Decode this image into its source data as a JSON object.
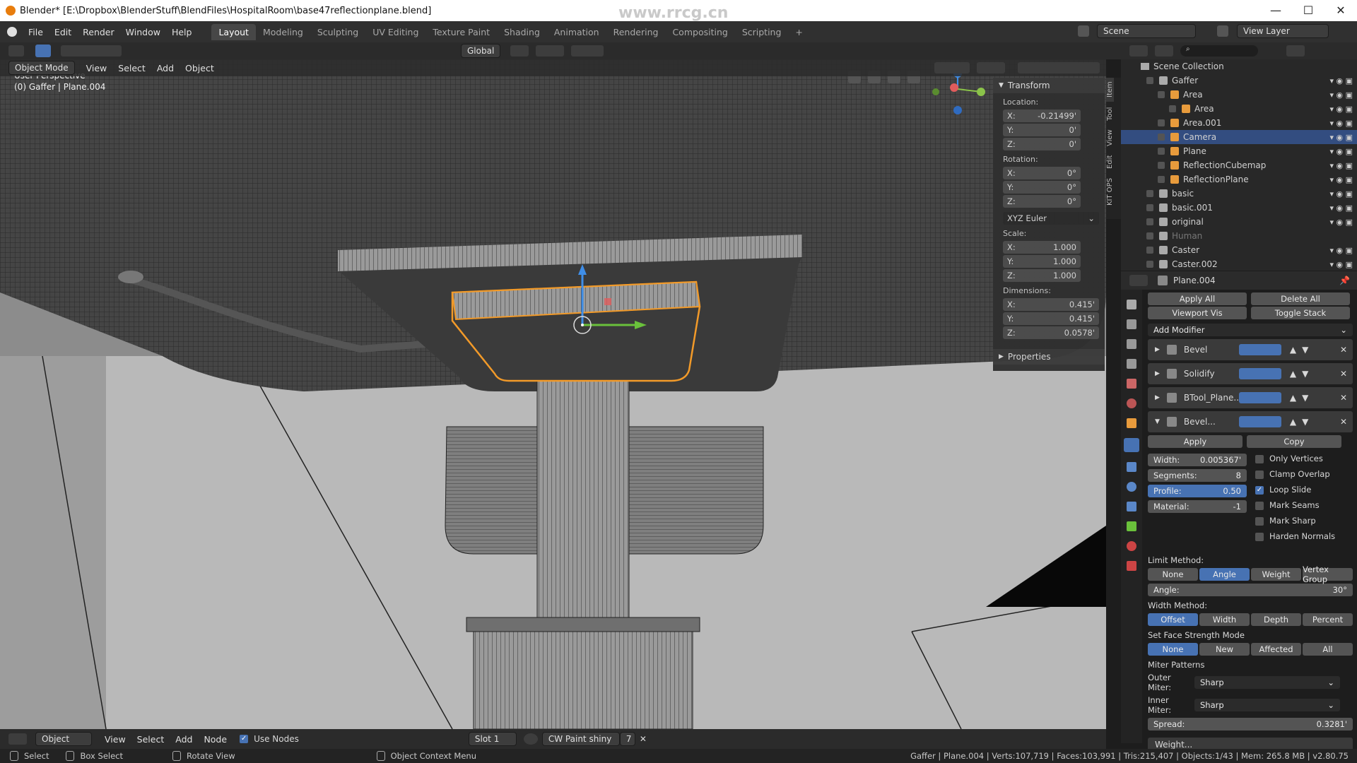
{
  "window": {
    "title": "Blender* [E:\\Dropbox\\BlenderStuff\\BlendFiles\\HospitalRoom\\base47reflectionplane.blend]",
    "watermark": "www.rrcg.cn"
  },
  "menu": {
    "items": [
      "File",
      "Edit",
      "Render",
      "Window",
      "Help"
    ],
    "workspaces": [
      "Layout",
      "Modeling",
      "Sculpting",
      "UV Editing",
      "Texture Paint",
      "Shading",
      "Animation",
      "Rendering",
      "Compositing",
      "Scripting"
    ],
    "active_workspace": "Layout",
    "scene": "Scene",
    "view_layer": "View Layer"
  },
  "viewport_header": {
    "mode": "Object Mode",
    "menus": [
      "View",
      "Select",
      "Add",
      "Object"
    ],
    "transform_orientation": "Global"
  },
  "viewport": {
    "view_name": "User Perspective",
    "object_info": "(0) Gaffer | Plane.004",
    "side_tabs": [
      "Item",
      "Tool",
      "View",
      "Edit",
      "KIT OPS"
    ]
  },
  "transform": {
    "title": "Transform",
    "location_label": "Location:",
    "location": {
      "x": "-0.21499'",
      "y": "0'",
      "z": "0'"
    },
    "rotation_label": "Rotation:",
    "rotation": {
      "x": "0°",
      "y": "0°",
      "z": "0°"
    },
    "rotation_mode": "XYZ Euler",
    "scale_label": "Scale:",
    "scale": {
      "x": "1.000",
      "y": "1.000",
      "z": "1.000"
    },
    "dimensions_label": "Dimensions:",
    "dimensions": {
      "x": "0.415'",
      "y": "0.415'",
      "z": "0.0578'"
    },
    "axis_x": "X:",
    "axis_y": "Y:",
    "axis_z": "Z:",
    "properties": "Properties"
  },
  "outliner": {
    "root": "Scene Collection",
    "rows": [
      {
        "label": "Gaffer",
        "indent": 1
      },
      {
        "label": "Area",
        "indent": 2
      },
      {
        "label": "Area",
        "indent": 3
      },
      {
        "label": "Area.001",
        "indent": 2
      },
      {
        "label": "Camera",
        "indent": 2,
        "selected": true
      },
      {
        "label": "Plane",
        "indent": 2
      },
      {
        "label": "ReflectionCubemap",
        "indent": 2
      },
      {
        "label": "ReflectionPlane",
        "indent": 2
      },
      {
        "label": "basic",
        "indent": 1
      },
      {
        "label": "basic.001",
        "indent": 1
      },
      {
        "label": "original",
        "indent": 1
      },
      {
        "label": "Human",
        "indent": 1,
        "dim": true
      },
      {
        "label": "Caster",
        "indent": 1
      },
      {
        "label": "Caster.002",
        "indent": 1
      }
    ]
  },
  "properties": {
    "object_name": "Plane.004",
    "apply_all": "Apply All",
    "delete_all": "Delete All",
    "viewport_vis": "Viewport Vis",
    "toggle_stack": "Toggle Stack",
    "add_modifier": "Add Modifier",
    "modifiers": [
      "Bevel",
      "Solidify",
      "BTool_Plane...",
      "Bevel..."
    ],
    "apply": "Apply",
    "copy": "Copy",
    "width_label": "Width:",
    "width": "0.005367'",
    "segments_label": "Segments:",
    "segments": "8",
    "profile_label": "Profile:",
    "profile": "0.50",
    "material_label": "Material:",
    "material": "-1",
    "checks": [
      {
        "label": "Only Vertices",
        "on": false
      },
      {
        "label": "Clamp Overlap",
        "on": false
      },
      {
        "label": "Loop Slide",
        "on": true
      },
      {
        "label": "Mark Seams",
        "on": false
      },
      {
        "label": "Mark Sharp",
        "on": false
      },
      {
        "label": "Harden Normals",
        "on": false
      }
    ],
    "limit_method": "Limit Method:",
    "limit_options": [
      "None",
      "Angle",
      "Weight",
      "Vertex Group"
    ],
    "limit_active": "Angle",
    "angle_label": "Angle:",
    "angle": "30°",
    "width_method": "Width Method:",
    "width_options": [
      "Offset",
      "Width",
      "Depth",
      "Percent"
    ],
    "width_active": "Offset",
    "face_strength": "Set Face Strength Mode",
    "face_options": [
      "None",
      "New",
      "Affected",
      "All"
    ],
    "face_active": "None",
    "miter_patterns": "Miter Patterns",
    "outer_miter_label": "Outer Miter:",
    "outer_miter": "Sharp",
    "inner_miter_label": "Inner Miter:",
    "inner_miter": "Sharp",
    "spread_label": "Spread:",
    "spread": "0.3281'",
    "next_modifier": "Weight..."
  },
  "node_header": {
    "type": "Object",
    "menus": [
      "View",
      "Select",
      "Add",
      "Node"
    ],
    "use_nodes": "Use Nodes",
    "slot": "Slot 1",
    "material": "CW Paint shiny",
    "users": "7"
  },
  "statusbar": {
    "select": "Select",
    "box_select": "Box Select",
    "rotate_view": "Rotate View",
    "context_menu": "Object Context Menu",
    "stats": "Gaffer | Plane.004 | Verts:107,719 | Faces:103,991 | Tris:215,407 | Objects:1/43 | Mem: 265.8 MB | v2.80.75"
  },
  "colors": {
    "accent": "#4772b3",
    "selection_outline": "#f29a29",
    "header": "#2b2b2b"
  }
}
